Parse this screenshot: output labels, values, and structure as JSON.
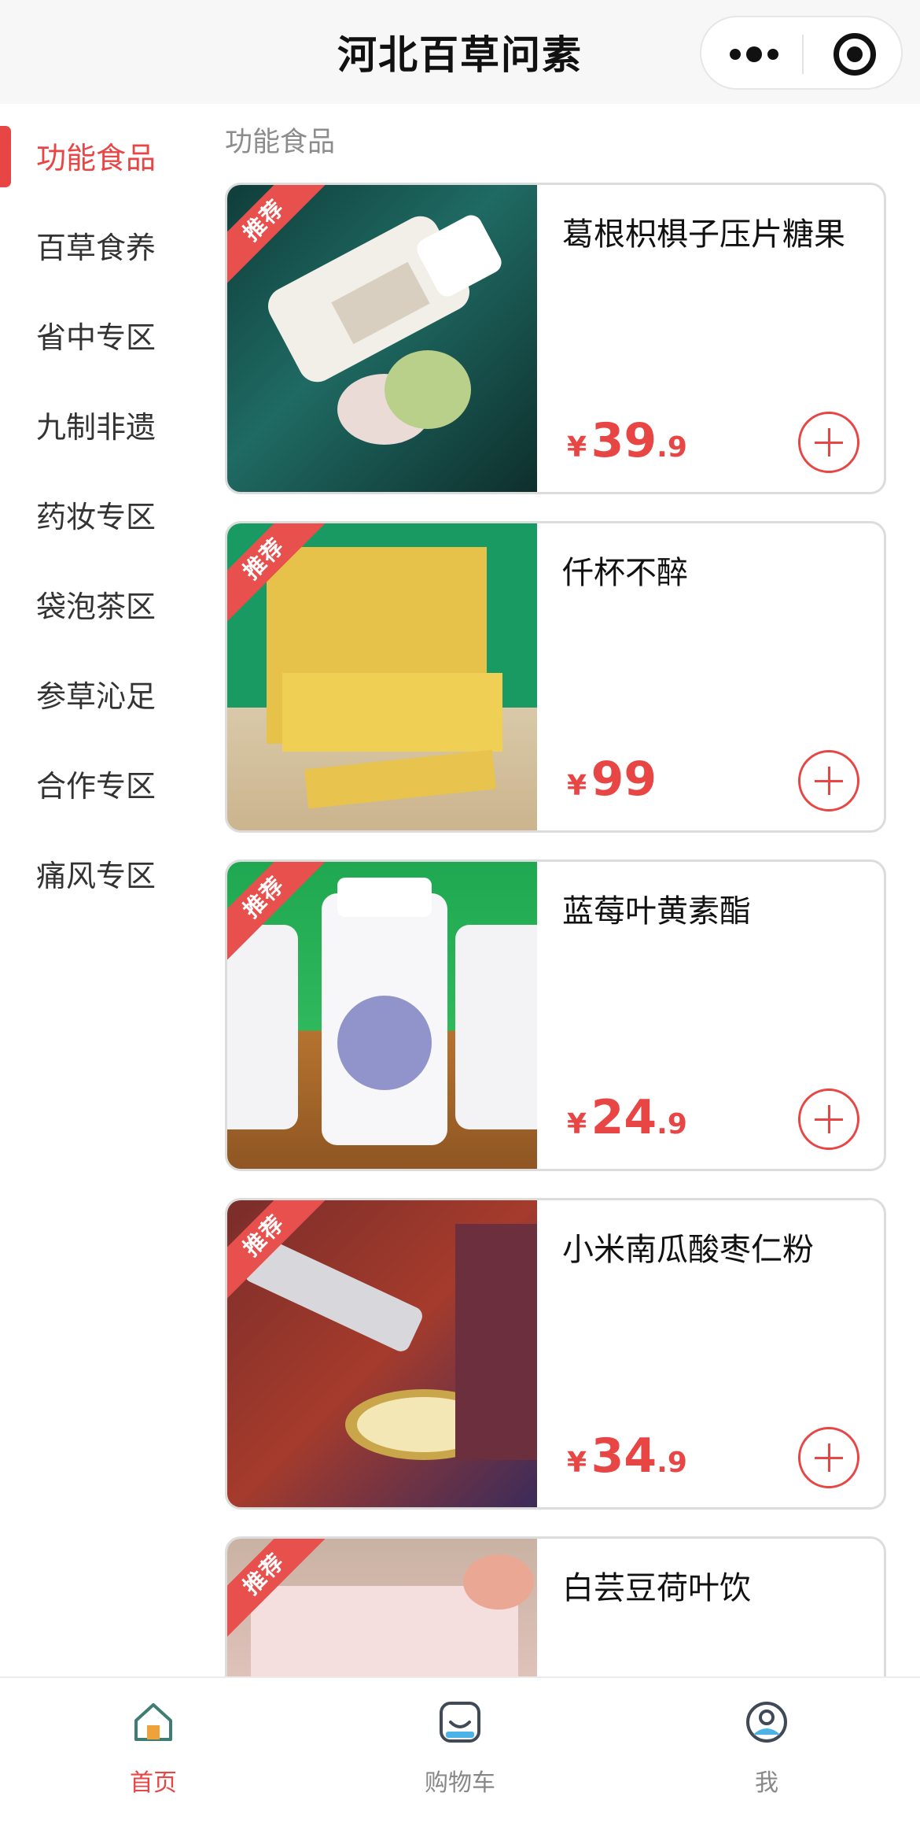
{
  "header": {
    "title": "河北百草问素",
    "more_icon": "more-dots-icon",
    "close_icon": "target-circle-icon"
  },
  "sidebar": {
    "items": [
      {
        "label": "功能食品",
        "active": true
      },
      {
        "label": "百草食养",
        "active": false
      },
      {
        "label": "省中专区",
        "active": false
      },
      {
        "label": "九制非遗",
        "active": false
      },
      {
        "label": "药妆专区",
        "active": false
      },
      {
        "label": "袋泡茶区",
        "active": false
      },
      {
        "label": "参草沁足",
        "active": false
      },
      {
        "label": "合作专区",
        "active": false
      },
      {
        "label": "痛风专区",
        "active": false
      }
    ]
  },
  "main": {
    "section_title": "功能食品",
    "ribbon_label": "推荐",
    "products": [
      {
        "name": "葛根枳椇子压片糖果",
        "currency": "¥",
        "price_int": "39",
        "price_dec": ".9"
      },
      {
        "name": "仟杯不醉",
        "currency": "¥",
        "price_int": "99",
        "price_dec": ""
      },
      {
        "name": "蓝莓叶黄素酯",
        "currency": "¥",
        "price_int": "24",
        "price_dec": ".9"
      },
      {
        "name": "小米南瓜酸枣仁粉",
        "currency": "¥",
        "price_int": "34",
        "price_dec": ".9"
      },
      {
        "name": "白芸豆荷叶饮",
        "currency": "¥",
        "price_int": "",
        "price_dec": ""
      }
    ]
  },
  "tabbar": {
    "tabs": [
      {
        "label": "首页",
        "icon": "home-icon",
        "active": true
      },
      {
        "label": "购物车",
        "icon": "cart-icon",
        "active": false
      },
      {
        "label": "我",
        "icon": "profile-icon",
        "active": false
      }
    ]
  },
  "colors": {
    "accent": "#e84545",
    "muted_text": "#8c8c8c",
    "border": "#dcdcdc"
  }
}
